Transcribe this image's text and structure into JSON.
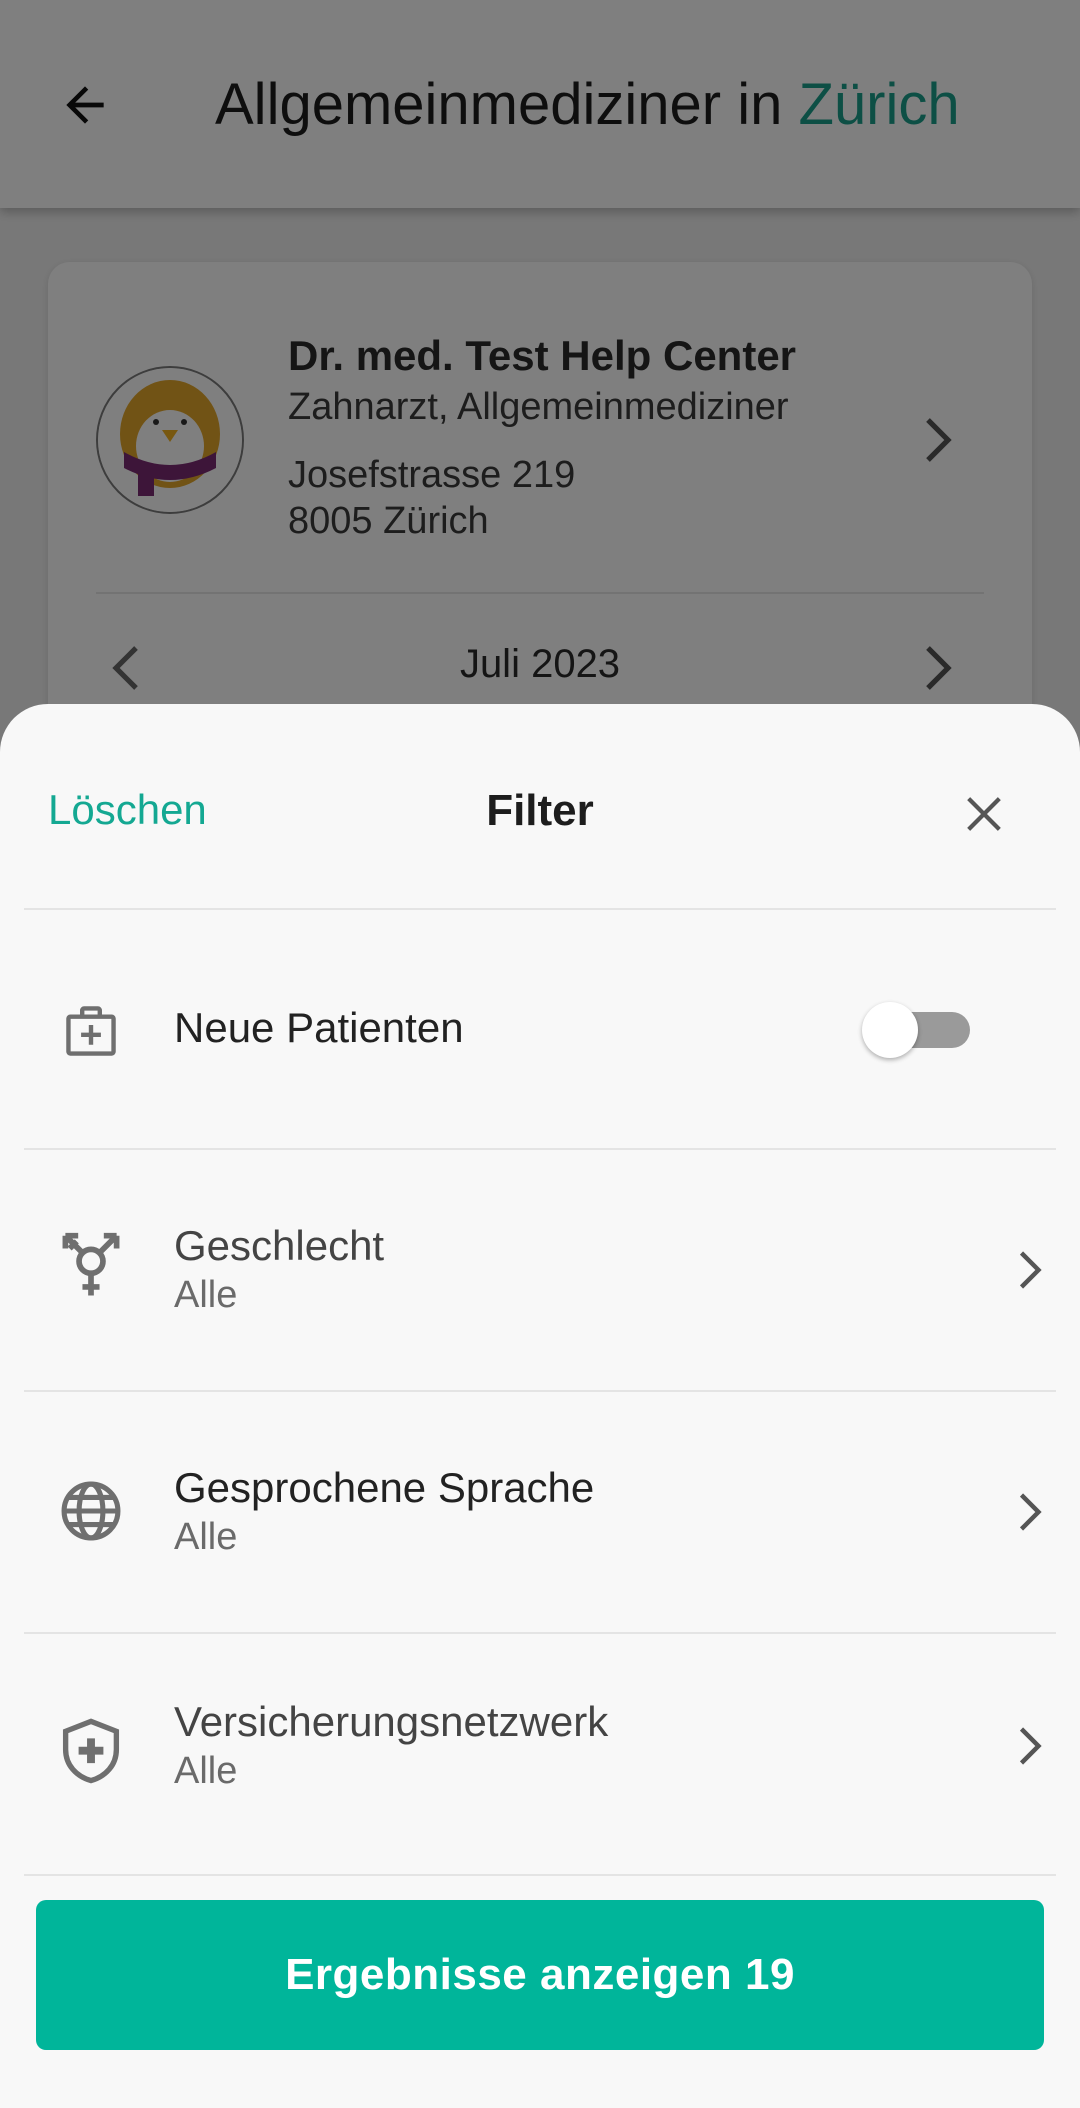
{
  "header": {
    "title_prefix": "Allgemeinmediziner in ",
    "title_city": "Zürich",
    "back_icon": "arrow-left-icon"
  },
  "doctor_card": {
    "name": "Dr. med. Test Help Center",
    "specialties": "Zahnarzt, Allgemeinmediziner",
    "address_line1": "Josefstrasse 219",
    "address_line2": "8005 Zürich",
    "month": "Juli 2023"
  },
  "filter_sheet": {
    "clear_label": "Löschen",
    "title": "Filter",
    "close_icon": "close-icon",
    "rows": [
      {
        "icon": "medical-kit-icon",
        "label": "Neue Patienten",
        "toggle_on": false
      },
      {
        "icon": "gender-icon",
        "label": "Geschlecht",
        "value": "Alle"
      },
      {
        "icon": "globe-icon",
        "label": "Gesprochene Sprache",
        "value": "Alle"
      },
      {
        "icon": "shield-plus-icon",
        "label": "Versicherungsnetzwerk",
        "value": "Alle"
      }
    ],
    "cta_label": "Ergebnisse anzeigen 19"
  },
  "colors": {
    "accent": "#00b59a",
    "accent_text": "#14a892",
    "city": "#1a9e8a"
  }
}
